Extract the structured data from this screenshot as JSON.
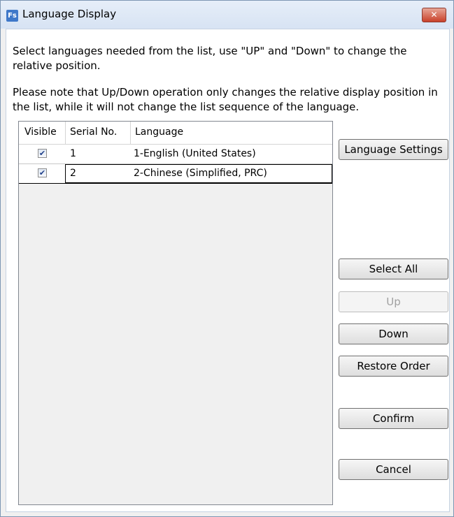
{
  "window": {
    "title": "Language Display",
    "app_icon_text": "Fs",
    "close_glyph": "✕"
  },
  "instructions": {
    "line1": "Select languages needed from the list, use \"UP\" and \"Down\" to change the relative position.",
    "line2": "Please note that Up/Down operation only changes the relative display position in the list, while it will not change the list sequence of the language."
  },
  "grid": {
    "columns": [
      "Visible",
      "Serial No.",
      "Language"
    ],
    "rows": [
      {
        "visible": true,
        "serial": "1",
        "language": "1-English (United States)"
      },
      {
        "visible": true,
        "serial": "2",
        "language": "2-Chinese (Simplified, PRC)"
      }
    ]
  },
  "buttons": {
    "language_settings": "Language Settings",
    "select_all": "Select All",
    "up": "Up",
    "down": "Down",
    "restore_order": "Restore Order",
    "confirm": "Confirm",
    "cancel": "Cancel"
  },
  "colors": {
    "title_gradient_top": "#e6eef9",
    "close_red": "#c9412a",
    "grid_bg": "#f0f0f0",
    "check_blue": "#1f3f8a"
  }
}
